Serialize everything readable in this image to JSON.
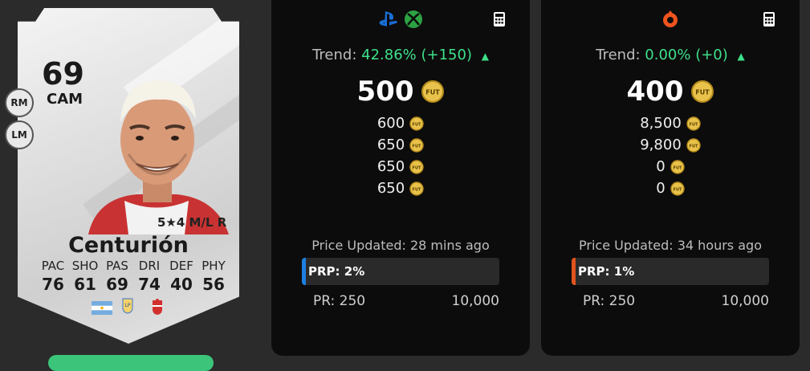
{
  "card": {
    "rating": "69",
    "position": "CAM",
    "alt_positions": [
      "RM",
      "LM"
    ],
    "skills": "5★4 M/L R",
    "name": "Centurión",
    "stats": [
      {
        "label": "PAC",
        "value": "76"
      },
      {
        "label": "SHO",
        "value": "61"
      },
      {
        "label": "PAS",
        "value": "69"
      },
      {
        "label": "DRI",
        "value": "74"
      },
      {
        "label": "DEF",
        "value": "40"
      },
      {
        "label": "PHY",
        "value": "56"
      }
    ],
    "nation_icon": "argentina-flag",
    "league_icon": "liga-profesional-icon",
    "club_icon": "club-crest-icon"
  },
  "console_panel": {
    "platform_icons": [
      "playstation-icon",
      "xbox-icon"
    ],
    "trend_label": "Trend:",
    "trend_value": "42.86% (+150)",
    "price": "500",
    "prices": [
      "600",
      "650",
      "650",
      "650"
    ],
    "updated": "Price Updated: 28 mins ago",
    "prp_label": "PRP: 2%",
    "prp_percent": 2,
    "prp_color": "#1e7fe0",
    "pr_min": "PR: 250",
    "pr_max": "10,000"
  },
  "pc_panel": {
    "platform_icons": [
      "origin-icon"
    ],
    "trend_label": "Trend:",
    "trend_value": "0.00% (+0)",
    "price": "400",
    "prices": [
      "8,500",
      "9,800",
      "0",
      "0"
    ],
    "updated": "Price Updated: 34 hours ago",
    "prp_label": "PRP: 1%",
    "prp_percent": 1,
    "prp_color": "#e0541e",
    "pr_min": "PR: 250",
    "pr_max": "10,000"
  },
  "colors": {
    "trend_up": "#3ee08a",
    "coin_gold": "#e8c24a",
    "panel_bg": "#0c0c0c"
  }
}
